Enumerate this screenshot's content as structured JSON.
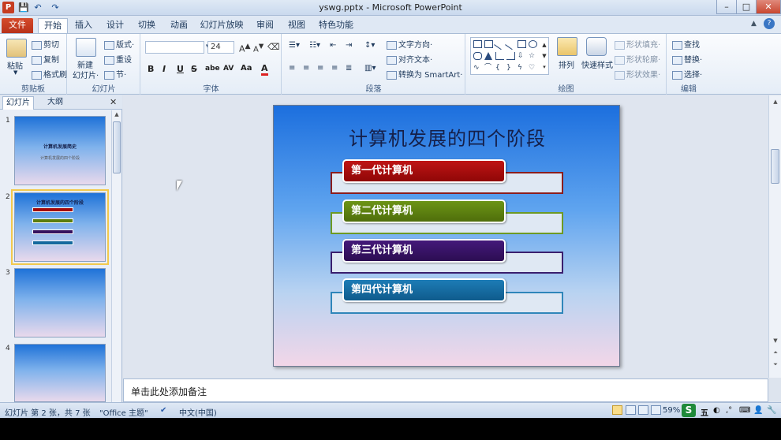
{
  "window": {
    "title": "yswg.pptx - Microsoft PowerPoint",
    "app_icon": "P"
  },
  "quick_access": {
    "save": "💾",
    "undo": "↶",
    "redo": "↷"
  },
  "window_controls": {
    "minimize": "–",
    "restore": "□",
    "close": "✕"
  },
  "tabs": [
    "文件",
    "开始",
    "插入",
    "设计",
    "切换",
    "动画",
    "幻灯片放映",
    "审阅",
    "视图",
    "特色功能"
  ],
  "ribbon": {
    "clipboard": {
      "label": "剪贴板",
      "paste": "粘贴",
      "cut": "剪切",
      "copy": "复制",
      "format_painter": "格式刷"
    },
    "slides": {
      "label": "幻灯片",
      "new_slide_line1": "新建",
      "new_slide_line2": "幻灯片·",
      "layout": "版式·",
      "reset": "重设",
      "section": "节·"
    },
    "font": {
      "label": "字体",
      "font_name": "",
      "font_size": "24",
      "bold": "B",
      "italic": "I",
      "underline": "U",
      "strike": "S",
      "shadow": "abe",
      "spacing": "AV",
      "case": "Aa",
      "color": "A"
    },
    "paragraph": {
      "label": "段落",
      "text_direction": "文字方向·",
      "align_text": "对齐文本·",
      "convert_smartart": "转换为 SmartArt·"
    },
    "drawing": {
      "label": "绘图",
      "arrange": "排列",
      "quick_styles": "快速样式",
      "shape_fill": "形状填充·",
      "shape_outline": "形状轮廓·",
      "shape_effects": "形状效果·"
    },
    "editing": {
      "label": "编辑",
      "find": "查找",
      "replace": "替换·",
      "select": "选择·"
    }
  },
  "left_pane": {
    "tabs": [
      "幻灯片",
      "大纲"
    ],
    "close": "✕",
    "thumbnails": [
      {
        "num": "1",
        "title": "计算机发展简史",
        "subtitle": "计算机发展的四个阶段"
      },
      {
        "num": "2",
        "title": "计算机发展的四个阶段",
        "subtitle": ""
      },
      {
        "num": "3",
        "title": "",
        "subtitle": ""
      },
      {
        "num": "4",
        "title": "",
        "subtitle": ""
      }
    ]
  },
  "slide": {
    "title": "计算机发展的四个阶段",
    "items": [
      {
        "label": "第一代计算机",
        "color": "#a10a0a",
        "border": "#8b1d1d"
      },
      {
        "label": "第二代计算机",
        "color": "#5b7d0e",
        "border": "#6e9a24"
      },
      {
        "label": "第三代计算机",
        "color": "#35115e",
        "border": "#3a1f6e"
      },
      {
        "label": "第四代计算机",
        "color": "#14699e",
        "border": "#2f86ba"
      }
    ]
  },
  "notes": {
    "placeholder": "单击此处添加备注"
  },
  "status": {
    "slide_info": "幻灯片 第 2 张，共 7 张",
    "theme": "\"Office 主题\"",
    "language": "中文(中国)",
    "zoom": "59%",
    "ime": "五"
  },
  "colors": {
    "accent": "#1e395b",
    "file_tab": "#c63d22"
  }
}
